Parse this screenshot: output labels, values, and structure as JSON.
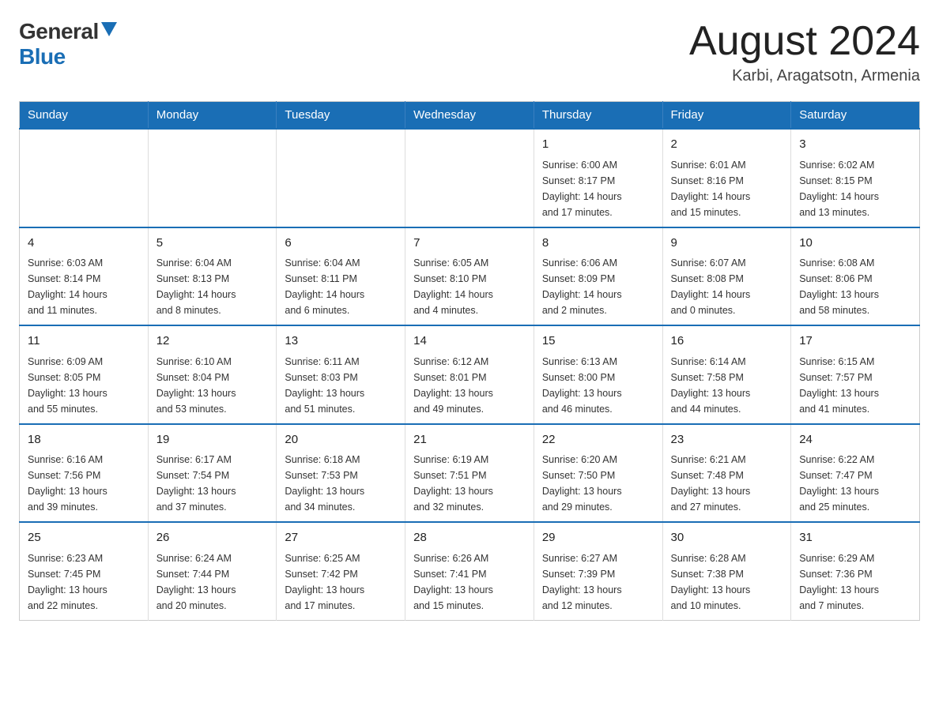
{
  "header": {
    "logo_general": "General",
    "logo_blue": "Blue",
    "month_title": "August 2024",
    "location": "Karbi, Aragatsotn, Armenia"
  },
  "weekdays": [
    "Sunday",
    "Monday",
    "Tuesday",
    "Wednesday",
    "Thursday",
    "Friday",
    "Saturday"
  ],
  "weeks": [
    [
      {
        "day": "",
        "info": ""
      },
      {
        "day": "",
        "info": ""
      },
      {
        "day": "",
        "info": ""
      },
      {
        "day": "",
        "info": ""
      },
      {
        "day": "1",
        "info": "Sunrise: 6:00 AM\nSunset: 8:17 PM\nDaylight: 14 hours\nand 17 minutes."
      },
      {
        "day": "2",
        "info": "Sunrise: 6:01 AM\nSunset: 8:16 PM\nDaylight: 14 hours\nand 15 minutes."
      },
      {
        "day": "3",
        "info": "Sunrise: 6:02 AM\nSunset: 8:15 PM\nDaylight: 14 hours\nand 13 minutes."
      }
    ],
    [
      {
        "day": "4",
        "info": "Sunrise: 6:03 AM\nSunset: 8:14 PM\nDaylight: 14 hours\nand 11 minutes."
      },
      {
        "day": "5",
        "info": "Sunrise: 6:04 AM\nSunset: 8:13 PM\nDaylight: 14 hours\nand 8 minutes."
      },
      {
        "day": "6",
        "info": "Sunrise: 6:04 AM\nSunset: 8:11 PM\nDaylight: 14 hours\nand 6 minutes."
      },
      {
        "day": "7",
        "info": "Sunrise: 6:05 AM\nSunset: 8:10 PM\nDaylight: 14 hours\nand 4 minutes."
      },
      {
        "day": "8",
        "info": "Sunrise: 6:06 AM\nSunset: 8:09 PM\nDaylight: 14 hours\nand 2 minutes."
      },
      {
        "day": "9",
        "info": "Sunrise: 6:07 AM\nSunset: 8:08 PM\nDaylight: 14 hours\nand 0 minutes."
      },
      {
        "day": "10",
        "info": "Sunrise: 6:08 AM\nSunset: 8:06 PM\nDaylight: 13 hours\nand 58 minutes."
      }
    ],
    [
      {
        "day": "11",
        "info": "Sunrise: 6:09 AM\nSunset: 8:05 PM\nDaylight: 13 hours\nand 55 minutes."
      },
      {
        "day": "12",
        "info": "Sunrise: 6:10 AM\nSunset: 8:04 PM\nDaylight: 13 hours\nand 53 minutes."
      },
      {
        "day": "13",
        "info": "Sunrise: 6:11 AM\nSunset: 8:03 PM\nDaylight: 13 hours\nand 51 minutes."
      },
      {
        "day": "14",
        "info": "Sunrise: 6:12 AM\nSunset: 8:01 PM\nDaylight: 13 hours\nand 49 minutes."
      },
      {
        "day": "15",
        "info": "Sunrise: 6:13 AM\nSunset: 8:00 PM\nDaylight: 13 hours\nand 46 minutes."
      },
      {
        "day": "16",
        "info": "Sunrise: 6:14 AM\nSunset: 7:58 PM\nDaylight: 13 hours\nand 44 minutes."
      },
      {
        "day": "17",
        "info": "Sunrise: 6:15 AM\nSunset: 7:57 PM\nDaylight: 13 hours\nand 41 minutes."
      }
    ],
    [
      {
        "day": "18",
        "info": "Sunrise: 6:16 AM\nSunset: 7:56 PM\nDaylight: 13 hours\nand 39 minutes."
      },
      {
        "day": "19",
        "info": "Sunrise: 6:17 AM\nSunset: 7:54 PM\nDaylight: 13 hours\nand 37 minutes."
      },
      {
        "day": "20",
        "info": "Sunrise: 6:18 AM\nSunset: 7:53 PM\nDaylight: 13 hours\nand 34 minutes."
      },
      {
        "day": "21",
        "info": "Sunrise: 6:19 AM\nSunset: 7:51 PM\nDaylight: 13 hours\nand 32 minutes."
      },
      {
        "day": "22",
        "info": "Sunrise: 6:20 AM\nSunset: 7:50 PM\nDaylight: 13 hours\nand 29 minutes."
      },
      {
        "day": "23",
        "info": "Sunrise: 6:21 AM\nSunset: 7:48 PM\nDaylight: 13 hours\nand 27 minutes."
      },
      {
        "day": "24",
        "info": "Sunrise: 6:22 AM\nSunset: 7:47 PM\nDaylight: 13 hours\nand 25 minutes."
      }
    ],
    [
      {
        "day": "25",
        "info": "Sunrise: 6:23 AM\nSunset: 7:45 PM\nDaylight: 13 hours\nand 22 minutes."
      },
      {
        "day": "26",
        "info": "Sunrise: 6:24 AM\nSunset: 7:44 PM\nDaylight: 13 hours\nand 20 minutes."
      },
      {
        "day": "27",
        "info": "Sunrise: 6:25 AM\nSunset: 7:42 PM\nDaylight: 13 hours\nand 17 minutes."
      },
      {
        "day": "28",
        "info": "Sunrise: 6:26 AM\nSunset: 7:41 PM\nDaylight: 13 hours\nand 15 minutes."
      },
      {
        "day": "29",
        "info": "Sunrise: 6:27 AM\nSunset: 7:39 PM\nDaylight: 13 hours\nand 12 minutes."
      },
      {
        "day": "30",
        "info": "Sunrise: 6:28 AM\nSunset: 7:38 PM\nDaylight: 13 hours\nand 10 minutes."
      },
      {
        "day": "31",
        "info": "Sunrise: 6:29 AM\nSunset: 7:36 PM\nDaylight: 13 hours\nand 7 minutes."
      }
    ]
  ]
}
